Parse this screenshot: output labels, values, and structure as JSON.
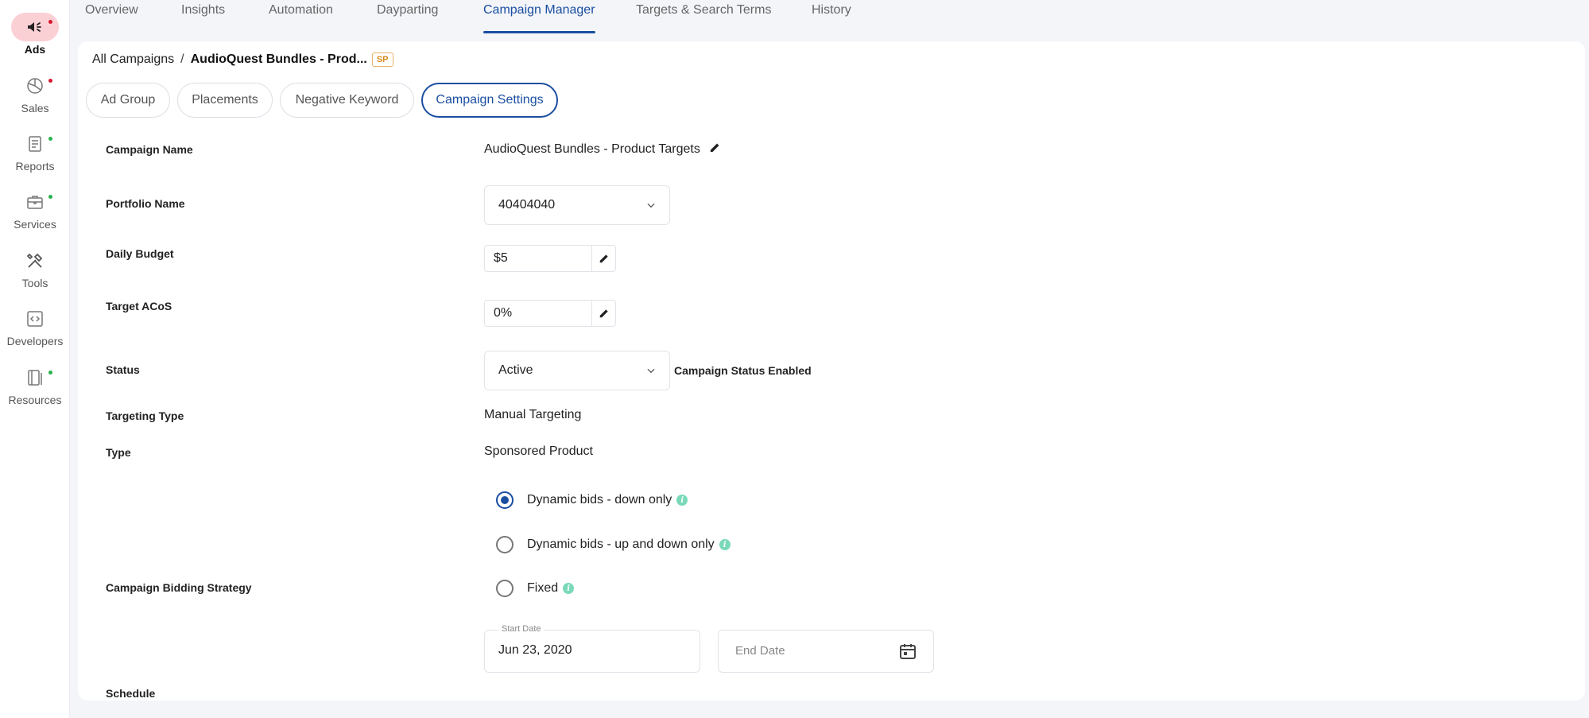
{
  "sidebar": {
    "items": [
      {
        "label": "Ads",
        "icon": "megaphone-icon",
        "dot": "#d8182f",
        "active": true
      },
      {
        "label": "Sales",
        "icon": "pie-chart-icon",
        "dot": "#d8182f"
      },
      {
        "label": "Reports",
        "icon": "report-icon",
        "dot": "#27b34a"
      },
      {
        "label": "Services",
        "icon": "briefcase-icon",
        "dot": "#27b34a"
      },
      {
        "label": "Tools",
        "icon": "tools-icon",
        "dot": ""
      },
      {
        "label": "Developers",
        "icon": "code-icon",
        "dot": ""
      },
      {
        "label": "Resources",
        "icon": "book-icon",
        "dot": "#27b34a"
      }
    ]
  },
  "top_tabs": [
    "Overview",
    "Insights",
    "Automation",
    "Dayparting",
    "Campaign Manager",
    "Targets & Search Terms",
    "History"
  ],
  "active_top_tab": "Campaign Manager",
  "breadcrumb": {
    "root": "All Campaigns",
    "separator": "/",
    "current": "AudioQuest Bundles - Prod...",
    "badge": "SP"
  },
  "sub_tabs": [
    "Ad Group",
    "Placements",
    "Negative Keyword",
    "Campaign Settings"
  ],
  "active_sub_tab": "Campaign Settings",
  "form": {
    "campaign_name": {
      "label": "Campaign Name",
      "value": "AudioQuest Bundles - Product Targets"
    },
    "portfolio_name": {
      "label": "Portfolio Name",
      "value": "40404040"
    },
    "daily_budget": {
      "label": "Daily Budget",
      "value": "$5"
    },
    "target_acos": {
      "label": "Target ACoS",
      "value": "0%"
    },
    "status": {
      "label": "Status",
      "value": "Active",
      "note": "Campaign Status Enabled"
    },
    "targeting_type": {
      "label": "Targeting Type",
      "value": "Manual Targeting"
    },
    "type": {
      "label": "Type",
      "value": "Sponsored Product"
    },
    "bidding_strategy": {
      "label": "Campaign Bidding Strategy",
      "options": [
        "Dynamic bids - down only",
        "Dynamic bids - up and down only",
        "Fixed"
      ],
      "selected": "Dynamic bids - down only"
    },
    "schedule": {
      "label": "Schedule",
      "start_label": "Start Date",
      "start_value": "Jun 23, 2020",
      "end_placeholder": "End Date"
    }
  },
  "colors": {
    "accent": "#1b4ea1",
    "ads_active_bg": "#fbd0d5",
    "info": "#79d9b8",
    "badge": "#d98a1a"
  }
}
